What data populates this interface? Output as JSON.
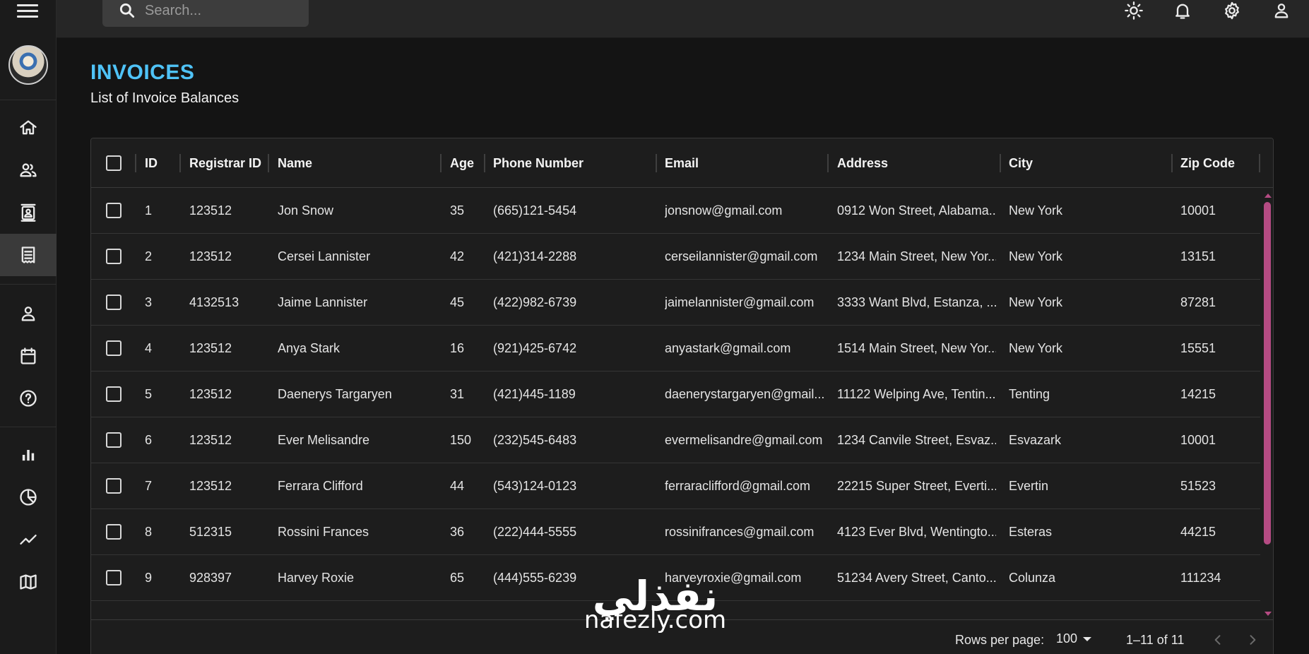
{
  "topbar": {
    "search_placeholder": "Search...",
    "icons": [
      "light-mode-icon",
      "notifications-icon",
      "settings-icon",
      "profile-icon"
    ]
  },
  "sidebar": {
    "icons": [
      "home-icon",
      "team-icon",
      "contacts-icon",
      "invoices-icon",
      "profile-form-icon",
      "calendar-icon",
      "faq-icon",
      "bar-chart-icon",
      "pie-chart-icon",
      "line-chart-icon",
      "geography-icon"
    ],
    "active": "invoices-icon"
  },
  "header": {
    "title": "INVOICES",
    "subtitle": "List of Invoice Balances"
  },
  "table": {
    "columns": [
      "ID",
      "Registrar ID",
      "Name",
      "Age",
      "Phone Number",
      "Email",
      "Address",
      "City",
      "Zip Code"
    ],
    "rows": [
      [
        "1",
        "123512",
        "Jon Snow",
        "35",
        "(665)121-5454",
        "jonsnow@gmail.com",
        "0912 Won Street, Alabama...",
        "New York",
        "10001"
      ],
      [
        "2",
        "123512",
        "Cersei Lannister",
        "42",
        "(421)314-2288",
        "cerseilannister@gmail.com",
        "1234 Main Street, New Yor...",
        "New York",
        "13151"
      ],
      [
        "3",
        "4132513",
        "Jaime Lannister",
        "45",
        "(422)982-6739",
        "jaimelannister@gmail.com",
        "3333 Want Blvd, Estanza, ...",
        "New York",
        "87281"
      ],
      [
        "4",
        "123512",
        "Anya Stark",
        "16",
        "(921)425-6742",
        "anyastark@gmail.com",
        "1514 Main Street, New Yor...",
        "New York",
        "15551"
      ],
      [
        "5",
        "123512",
        "Daenerys Targaryen",
        "31",
        "(421)445-1189",
        "daenerystargaryen@gmail...",
        "11122 Welping Ave, Tentin...",
        "Tenting",
        "14215"
      ],
      [
        "6",
        "123512",
        "Ever Melisandre",
        "150",
        "(232)545-6483",
        "evermelisandre@gmail.com",
        "1234 Canvile Street, Esvaz...",
        "Esvazark",
        "10001"
      ],
      [
        "7",
        "123512",
        "Ferrara Clifford",
        "44",
        "(543)124-0123",
        "ferraraclifford@gmail.com",
        "22215 Super Street, Everti...",
        "Evertin",
        "51523"
      ],
      [
        "8",
        "512315",
        "Rossini Frances",
        "36",
        "(222)444-5555",
        "rossinifrances@gmail.com",
        "4123 Ever Blvd, Wentingto...",
        "Esteras",
        "44215"
      ],
      [
        "9",
        "928397",
        "Harvey Roxie",
        "65",
        "(444)555-6239",
        "harveyroxie@gmail.com",
        "51234 Avery Street, Canto...",
        "Colunza",
        "111234"
      ]
    ]
  },
  "pagination": {
    "rows_per_page_label": "Rows per page:",
    "rows_per_page_value": "100",
    "range": "1–11 of 11"
  },
  "watermark": {
    "arabic": "نفذلي",
    "latin": "nafezly.com"
  },
  "colors": {
    "accent": "#4fc3f7",
    "scrollbar": "#b54b83",
    "background": "#141414"
  }
}
